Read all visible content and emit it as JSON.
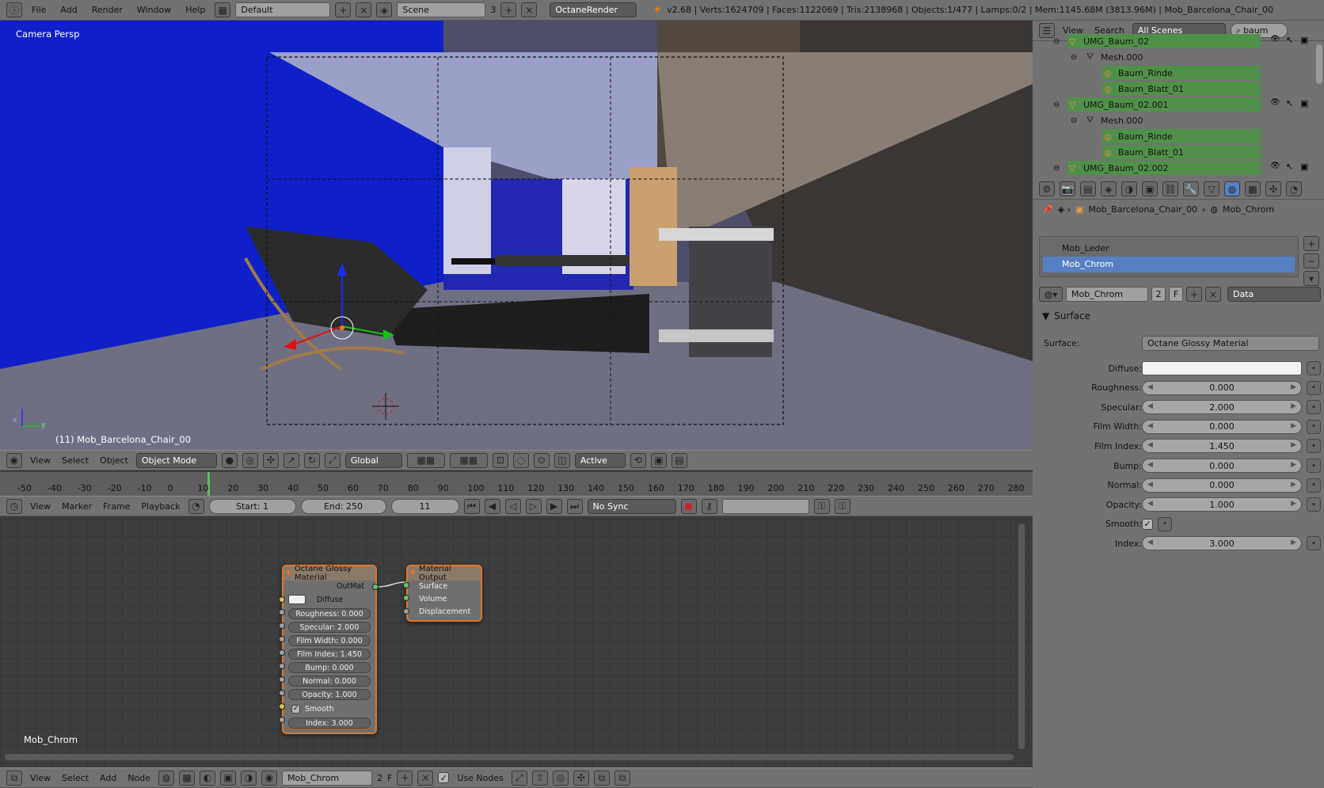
{
  "topbar": {
    "menus": [
      "File",
      "Add",
      "Render",
      "Window",
      "Help"
    ],
    "layout": "Default",
    "scene": "Scene",
    "scene_users": "3",
    "render_engine": "OctaneRender",
    "stats": "v2.68 | Verts:1624709 | Faces:1122069 | Tris:2138968 | Objects:1/477 | Lamps:0/2 | Mem:1145.68M (3813.96M) | Mob_Barcelona_Chair_00"
  },
  "viewport": {
    "view_label": "Camera Persp",
    "object_label": "(11) Mob_Barcelona_Chair_00",
    "axis_x": "x",
    "axis_y": "y"
  },
  "view3d_header": {
    "menus": [
      "View",
      "Select",
      "Object"
    ],
    "mode": "Object Mode",
    "orientation": "Global",
    "pivot": "Active"
  },
  "timeline": {
    "ticks": [
      "-50",
      "-40",
      "-30",
      "-20",
      "-10",
      "0",
      "10",
      "20",
      "30",
      "40",
      "50",
      "60",
      "70",
      "80",
      "90",
      "100",
      "110",
      "120",
      "130",
      "140",
      "150",
      "160",
      "170",
      "180",
      "190",
      "200",
      "210",
      "220",
      "230",
      "240",
      "250",
      "260",
      "270",
      "280"
    ]
  },
  "timeline_header": {
    "menus": [
      "View",
      "Marker",
      "Frame",
      "Playback"
    ],
    "start": "Start: 1",
    "end": "End: 250",
    "current": "11",
    "sync": "No Sync"
  },
  "node_editor": {
    "material_label": "Mob_Chrom",
    "glossy_node": {
      "title": "Octane Glossy Material",
      "output": "OutMat",
      "diffuse_label": "Diffuse",
      "props": [
        "Roughness: 0.000",
        "Specular: 2.000",
        "Film Width: 0.000",
        "Film Index: 1.450",
        "Bump: 0.000",
        "Normal: 0.000",
        "Opacity: 1.000"
      ],
      "smooth_label": "Smooth",
      "index": "Index: 3.000"
    },
    "output_node": {
      "title": "Material Output",
      "inputs": [
        "Surface",
        "Volume",
        "Displacement"
      ]
    }
  },
  "node_header": {
    "menus": [
      "View",
      "Select",
      "Add",
      "Node"
    ],
    "material": "Mob_Chrom",
    "users": "2",
    "fake": "F",
    "use_nodes": "Use Nodes"
  },
  "outliner": {
    "menus": [
      "View",
      "Search"
    ],
    "scope": "All Scenes",
    "search": "baum",
    "rows": [
      {
        "label": "UMG_Baum_02",
        "indent": 1,
        "type": "object",
        "hl": true
      },
      {
        "label": "Mesh.000",
        "indent": 2,
        "type": "mesh",
        "hl": false
      },
      {
        "label": "Baum_Rinde",
        "indent": 3,
        "type": "material",
        "hl": true
      },
      {
        "label": "Baum_Blatt_01",
        "indent": 3,
        "type": "material",
        "hl": true
      },
      {
        "label": "UMG_Baum_02.001",
        "indent": 1,
        "type": "object",
        "hl": true
      },
      {
        "label": "Mesh.000",
        "indent": 2,
        "type": "mesh",
        "hl": false
      },
      {
        "label": "Baum_Rinde",
        "indent": 3,
        "type": "material",
        "hl": true
      },
      {
        "label": "Baum_Blatt_01",
        "indent": 3,
        "type": "material",
        "hl": true
      },
      {
        "label": "UMG_Baum_02.002",
        "indent": 1,
        "type": "object",
        "hl": true
      }
    ]
  },
  "properties": {
    "breadcrumb_object": "Mob_Barcelona_Chair_00",
    "breadcrumb_material": "Mob_Chrom",
    "slots": [
      "Mob_Leder",
      "Mob_Chrom"
    ],
    "selected_slot": "Mob_Chrom",
    "material_name": "Mob_Chrom",
    "material_users": "2",
    "fake_user": "F",
    "link": "Data",
    "panel_title": "Surface",
    "surface_label": "Surface:",
    "surface_value": "Octane Glossy Material",
    "fields": [
      {
        "label": "Diffuse:",
        "value": ""
      },
      {
        "label": "Roughness:",
        "value": "0.000"
      },
      {
        "label": "Specular:",
        "value": "2.000"
      },
      {
        "label": "Film Width:",
        "value": "0.000"
      },
      {
        "label": "Film Index:",
        "value": "1.450"
      },
      {
        "label": "Bump:",
        "value": "0.000"
      },
      {
        "label": "Normal:",
        "value": "0.000"
      },
      {
        "label": "Opacity:",
        "value": "1.000"
      },
      {
        "label": "Smooth:",
        "value": ""
      },
      {
        "label": "Index:",
        "value": "3.000"
      }
    ]
  },
  "colors": {
    "accent_select": "#5680c2",
    "outliner_highlight": "#50904a",
    "node_border": "#e0762a"
  }
}
